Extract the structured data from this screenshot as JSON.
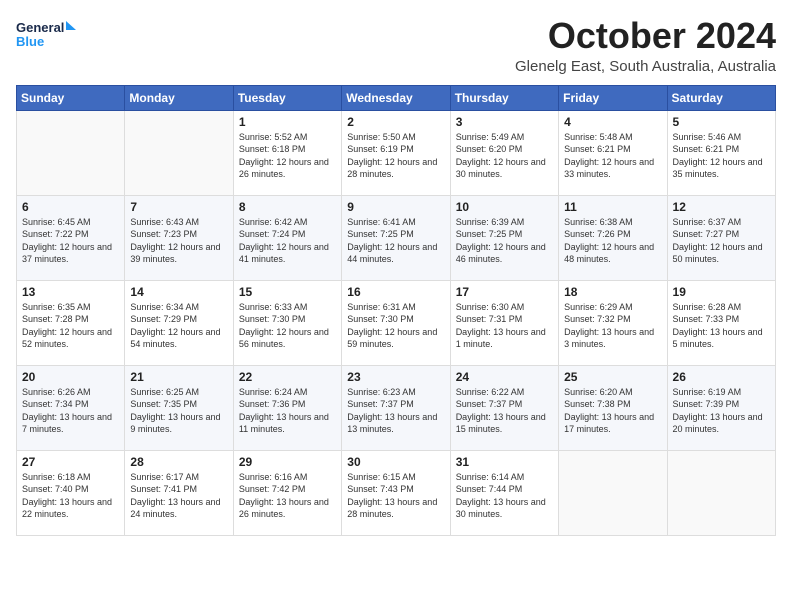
{
  "logo": {
    "line1": "General",
    "line2": "Blue"
  },
  "title": "October 2024",
  "subtitle": "Glenelg East, South Australia, Australia",
  "days_of_week": [
    "Sunday",
    "Monday",
    "Tuesday",
    "Wednesday",
    "Thursday",
    "Friday",
    "Saturday"
  ],
  "weeks": [
    [
      {
        "day": "",
        "info": ""
      },
      {
        "day": "",
        "info": ""
      },
      {
        "day": "1",
        "info": "Sunrise: 5:52 AM\nSunset: 6:18 PM\nDaylight: 12 hours and 26 minutes."
      },
      {
        "day": "2",
        "info": "Sunrise: 5:50 AM\nSunset: 6:19 PM\nDaylight: 12 hours and 28 minutes."
      },
      {
        "day": "3",
        "info": "Sunrise: 5:49 AM\nSunset: 6:20 PM\nDaylight: 12 hours and 30 minutes."
      },
      {
        "day": "4",
        "info": "Sunrise: 5:48 AM\nSunset: 6:21 PM\nDaylight: 12 hours and 33 minutes."
      },
      {
        "day": "5",
        "info": "Sunrise: 5:46 AM\nSunset: 6:21 PM\nDaylight: 12 hours and 35 minutes."
      }
    ],
    [
      {
        "day": "6",
        "info": "Sunrise: 6:45 AM\nSunset: 7:22 PM\nDaylight: 12 hours and 37 minutes."
      },
      {
        "day": "7",
        "info": "Sunrise: 6:43 AM\nSunset: 7:23 PM\nDaylight: 12 hours and 39 minutes."
      },
      {
        "day": "8",
        "info": "Sunrise: 6:42 AM\nSunset: 7:24 PM\nDaylight: 12 hours and 41 minutes."
      },
      {
        "day": "9",
        "info": "Sunrise: 6:41 AM\nSunset: 7:25 PM\nDaylight: 12 hours and 44 minutes."
      },
      {
        "day": "10",
        "info": "Sunrise: 6:39 AM\nSunset: 7:25 PM\nDaylight: 12 hours and 46 minutes."
      },
      {
        "day": "11",
        "info": "Sunrise: 6:38 AM\nSunset: 7:26 PM\nDaylight: 12 hours and 48 minutes."
      },
      {
        "day": "12",
        "info": "Sunrise: 6:37 AM\nSunset: 7:27 PM\nDaylight: 12 hours and 50 minutes."
      }
    ],
    [
      {
        "day": "13",
        "info": "Sunrise: 6:35 AM\nSunset: 7:28 PM\nDaylight: 12 hours and 52 minutes."
      },
      {
        "day": "14",
        "info": "Sunrise: 6:34 AM\nSunset: 7:29 PM\nDaylight: 12 hours and 54 minutes."
      },
      {
        "day": "15",
        "info": "Sunrise: 6:33 AM\nSunset: 7:30 PM\nDaylight: 12 hours and 56 minutes."
      },
      {
        "day": "16",
        "info": "Sunrise: 6:31 AM\nSunset: 7:30 PM\nDaylight: 12 hours and 59 minutes."
      },
      {
        "day": "17",
        "info": "Sunrise: 6:30 AM\nSunset: 7:31 PM\nDaylight: 13 hours and 1 minute."
      },
      {
        "day": "18",
        "info": "Sunrise: 6:29 AM\nSunset: 7:32 PM\nDaylight: 13 hours and 3 minutes."
      },
      {
        "day": "19",
        "info": "Sunrise: 6:28 AM\nSunset: 7:33 PM\nDaylight: 13 hours and 5 minutes."
      }
    ],
    [
      {
        "day": "20",
        "info": "Sunrise: 6:26 AM\nSunset: 7:34 PM\nDaylight: 13 hours and 7 minutes."
      },
      {
        "day": "21",
        "info": "Sunrise: 6:25 AM\nSunset: 7:35 PM\nDaylight: 13 hours and 9 minutes."
      },
      {
        "day": "22",
        "info": "Sunrise: 6:24 AM\nSunset: 7:36 PM\nDaylight: 13 hours and 11 minutes."
      },
      {
        "day": "23",
        "info": "Sunrise: 6:23 AM\nSunset: 7:37 PM\nDaylight: 13 hours and 13 minutes."
      },
      {
        "day": "24",
        "info": "Sunrise: 6:22 AM\nSunset: 7:37 PM\nDaylight: 13 hours and 15 minutes."
      },
      {
        "day": "25",
        "info": "Sunrise: 6:20 AM\nSunset: 7:38 PM\nDaylight: 13 hours and 17 minutes."
      },
      {
        "day": "26",
        "info": "Sunrise: 6:19 AM\nSunset: 7:39 PM\nDaylight: 13 hours and 20 minutes."
      }
    ],
    [
      {
        "day": "27",
        "info": "Sunrise: 6:18 AM\nSunset: 7:40 PM\nDaylight: 13 hours and 22 minutes."
      },
      {
        "day": "28",
        "info": "Sunrise: 6:17 AM\nSunset: 7:41 PM\nDaylight: 13 hours and 24 minutes."
      },
      {
        "day": "29",
        "info": "Sunrise: 6:16 AM\nSunset: 7:42 PM\nDaylight: 13 hours and 26 minutes."
      },
      {
        "day": "30",
        "info": "Sunrise: 6:15 AM\nSunset: 7:43 PM\nDaylight: 13 hours and 28 minutes."
      },
      {
        "day": "31",
        "info": "Sunrise: 6:14 AM\nSunset: 7:44 PM\nDaylight: 13 hours and 30 minutes."
      },
      {
        "day": "",
        "info": ""
      },
      {
        "day": "",
        "info": ""
      }
    ]
  ]
}
